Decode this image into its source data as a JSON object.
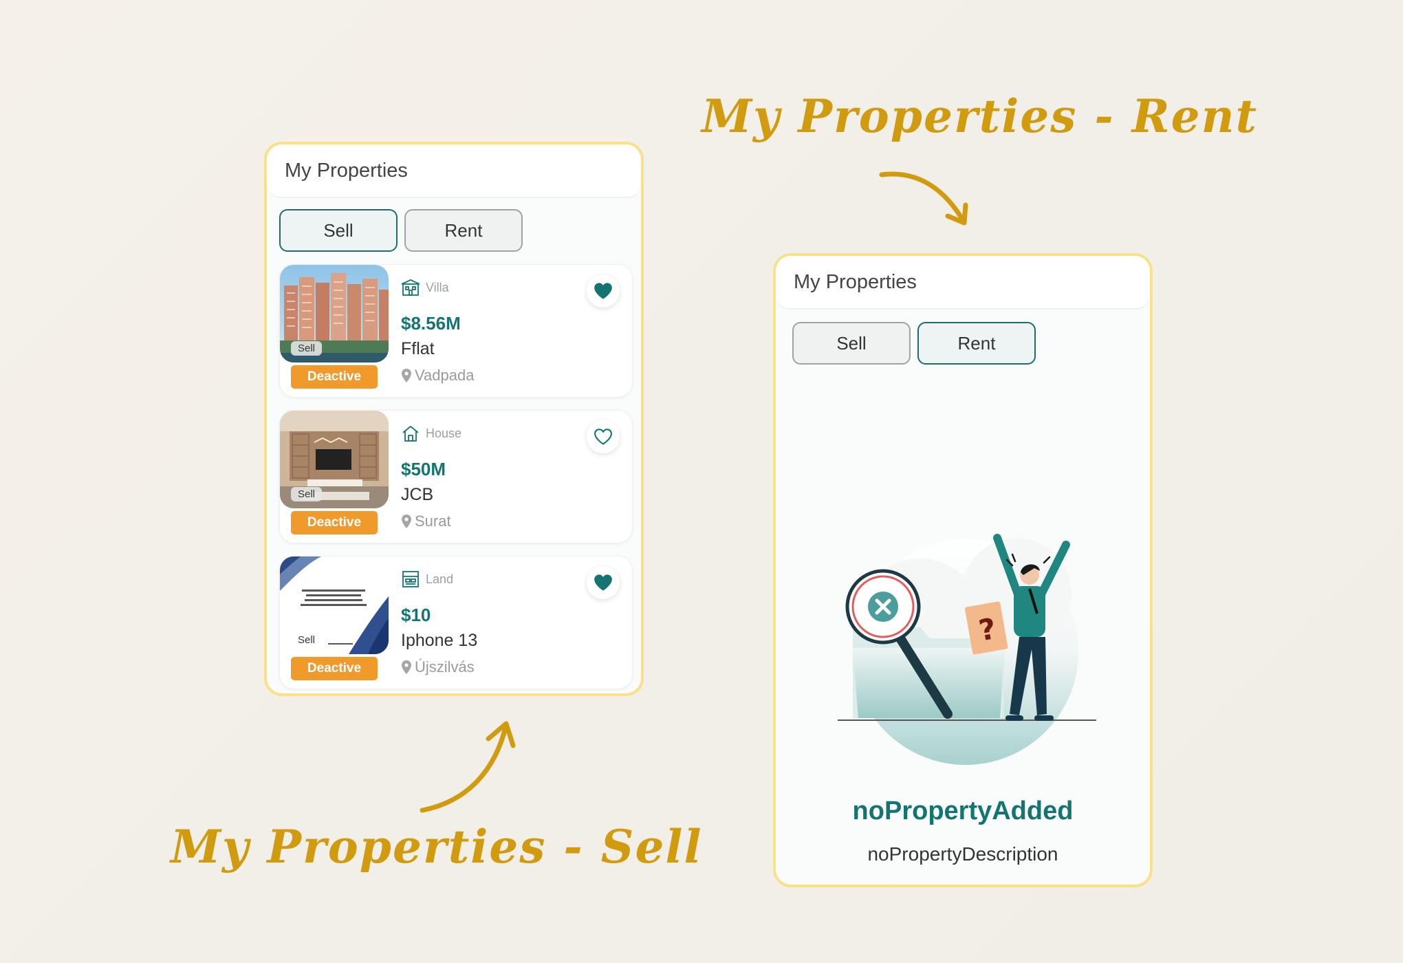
{
  "captions": {
    "rent": "My Properties - Rent",
    "sell": "My Properties - Sell"
  },
  "sell_screen": {
    "title": "My Properties",
    "tabs": [
      {
        "label": "Sell",
        "active": true
      },
      {
        "label": "Rent",
        "active": false
      }
    ],
    "properties": [
      {
        "type": "Villa",
        "type_icon": "building-icon",
        "price": "$8.56M",
        "name": "Fflat",
        "location": "Vadpada",
        "tag": "Sell",
        "status": "Deactive",
        "favorite": true,
        "image": "apartment-towers-photo"
      },
      {
        "type": "House",
        "type_icon": "house-icon",
        "price": "$50M",
        "name": "JCB",
        "location": "Surat",
        "tag": "Sell",
        "status": "Deactive",
        "favorite": false,
        "image": "living-room-photo"
      },
      {
        "type": "Land",
        "type_icon": "land-icon",
        "price": "$10",
        "name": "Iphone 13",
        "location": "Újszilvás",
        "tag": "Sell",
        "status": "Deactive",
        "favorite": true,
        "image": "quote-card-image"
      }
    ]
  },
  "rent_screen": {
    "title": "My Properties",
    "tabs": [
      {
        "label": "Sell",
        "active": false
      },
      {
        "label": "Rent",
        "active": true
      }
    ],
    "empty_title": "noPropertyAdded",
    "empty_description": "noPropertyDescription",
    "illustration": "no-results-illustration"
  },
  "colors": {
    "accent": "#137472",
    "caption": "#d19b10",
    "panel_border": "#fbe08a",
    "deactive_badge": "#f09a2c"
  }
}
